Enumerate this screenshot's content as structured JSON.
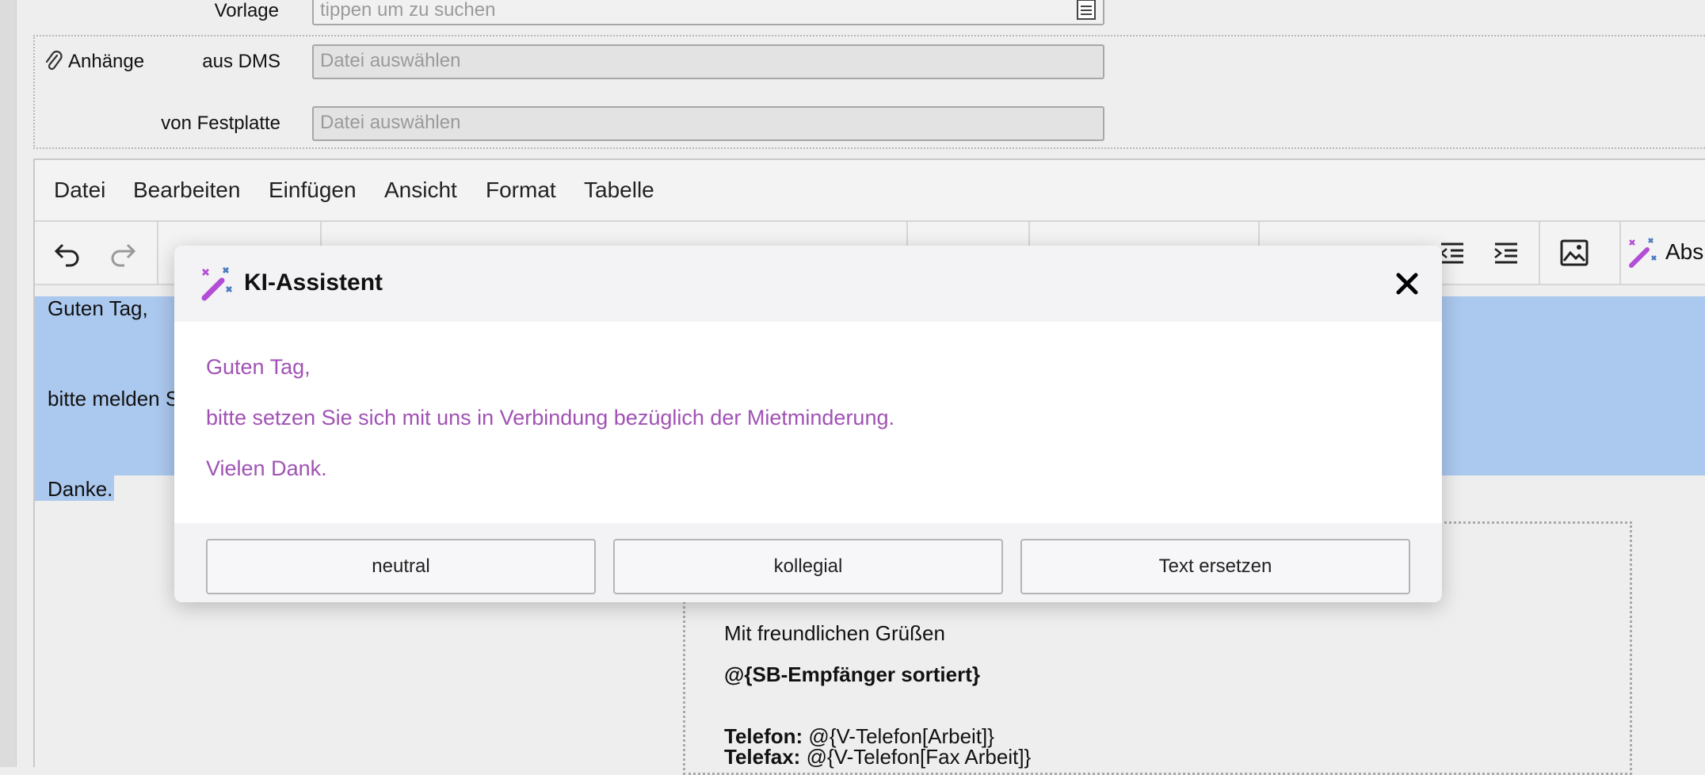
{
  "form": {
    "vorlage_label": "Vorlage",
    "vorlage_placeholder": "tippen um zu suchen",
    "attachments_label": "Anhänge",
    "dms_label": "aus DMS",
    "dms_placeholder": "Datei auswählen",
    "disk_label": "von Festplatte",
    "disk_placeholder": "Datei auswählen"
  },
  "editor": {
    "menu": [
      "Datei",
      "Bearbeiten",
      "Einfügen",
      "Ansicht",
      "Format",
      "Tabelle"
    ],
    "toolbar_partial_label": "Abs",
    "content": {
      "line1": "Guten Tag,",
      "line2_partial": "bitte melden S",
      "line3": "Danke."
    },
    "signature": {
      "greeting": "Mit freundlichen Grüßen",
      "recipient": "@{SB-Empfänger sortiert}",
      "phone_label": "Telefon:",
      "phone_value": "@{V-Telefon[Arbeit]}",
      "fax_label": "Telefax:",
      "fax_value": "@{V-Telefon[Fax Arbeit]}"
    }
  },
  "dialog": {
    "title": "KI-Assistent",
    "icon": "magic-wand-icon",
    "lines": [
      "Guten Tag,",
      "bitte setzen Sie sich mit uns in Verbindung bezüglich der Mietminderung.",
      "Vielen Dank."
    ],
    "buttons": {
      "neutral": "neutral",
      "kollegial": "kollegial",
      "replace": "Text ersetzen"
    }
  },
  "colors": {
    "ai_text": "#a052b4",
    "selection": "#abc8ee",
    "wand": "#b34dd6"
  }
}
